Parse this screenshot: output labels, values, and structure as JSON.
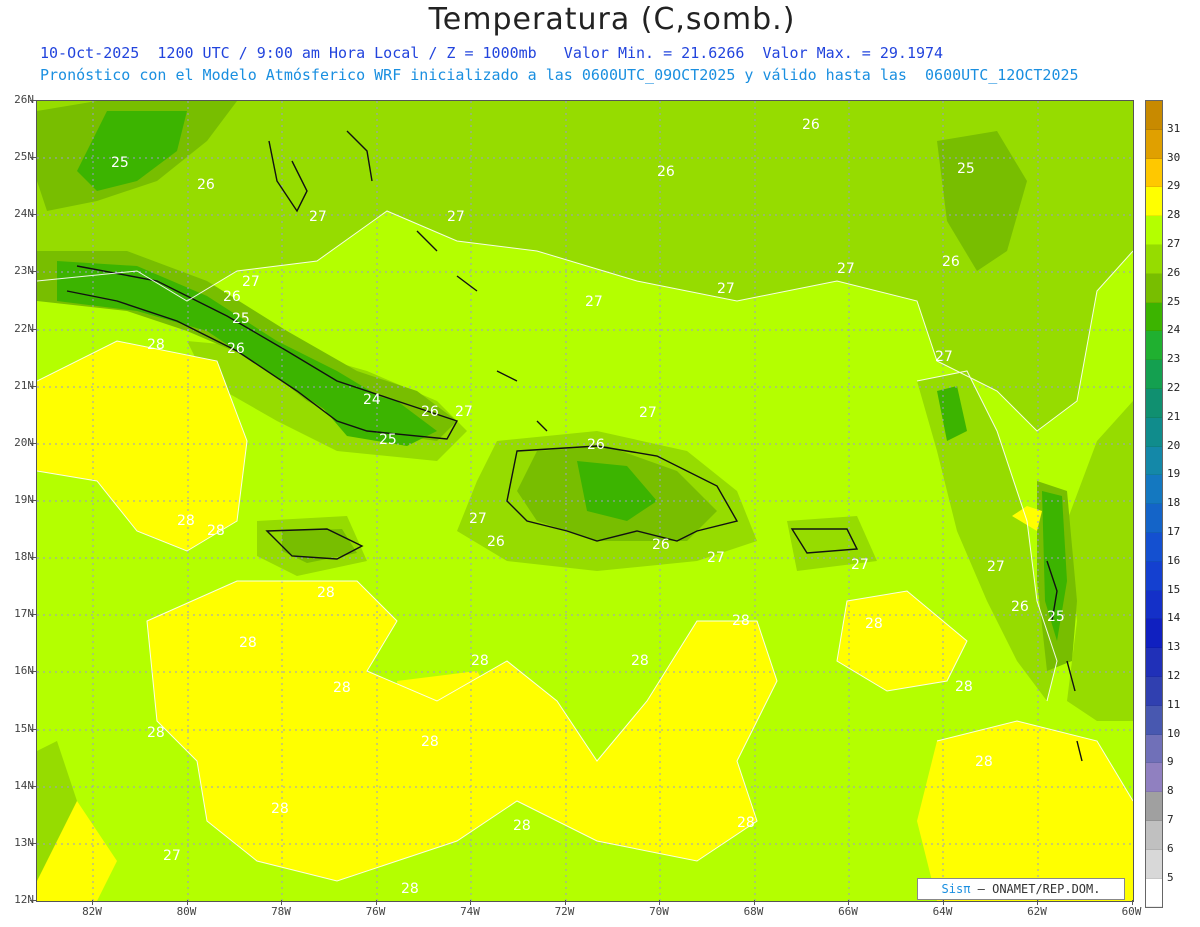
{
  "title": "Temperatura (C,somb.)",
  "subtitle_line1": "10-Oct-2025  1200 UTC / 9:00 am Hora Local / Z = 1000mb   Valor Min. = 21.6266  Valor Max. = 29.1974",
  "subtitle_line2": "Pronóstico con el Modelo Atmósferico WRF inicializado a las 0600UTC_09OCT2025 y válido hasta las  0600UTC_12OCT2025",
  "lat_labels": [
    "26N",
    "25N",
    "24N",
    "23N",
    "22N",
    "21N",
    "20N",
    "19N",
    "18N",
    "17N",
    "16N",
    "15N",
    "14N",
    "13N",
    "12N"
  ],
  "lon_labels": [
    "82W",
    "80W",
    "78W",
    "76W",
    "74W",
    "72W",
    "70W",
    "68W",
    "66W",
    "64W",
    "62W",
    "60W"
  ],
  "legend": {
    "labels": [
      "31",
      "30",
      "29",
      "28",
      "27",
      "26",
      "25",
      "24",
      "23",
      "22",
      "21",
      "20",
      "19",
      "18",
      "17",
      "16",
      "15",
      "14",
      "13",
      "12",
      "11",
      "10",
      "9",
      "8",
      "7",
      "6",
      "5"
    ],
    "colors": [
      "#c88a00",
      "#e0a000",
      "#ffc800",
      "#ffff00",
      "#b4ff00",
      "#96dc00",
      "#78be00",
      "#3cb400",
      "#20b030",
      "#14a050",
      "#109070",
      "#108c8c",
      "#1488a8",
      "#1478c0",
      "#1464c8",
      "#1450d0",
      "#1440d0",
      "#1430c8",
      "#1020c0",
      "#2030b8",
      "#3040b0",
      "#4858b0",
      "#7070b8",
      "#9080c0",
      "#a0a0a0",
      "#c0c0c0",
      "#d8d8d8",
      "#ffffff"
    ]
  },
  "contour_labels": [
    "24",
    "25",
    "26",
    "27",
    "28"
  ],
  "credit": {
    "sis": "Sisπ",
    "text": "– ONAMET/REP.DOM."
  }
}
